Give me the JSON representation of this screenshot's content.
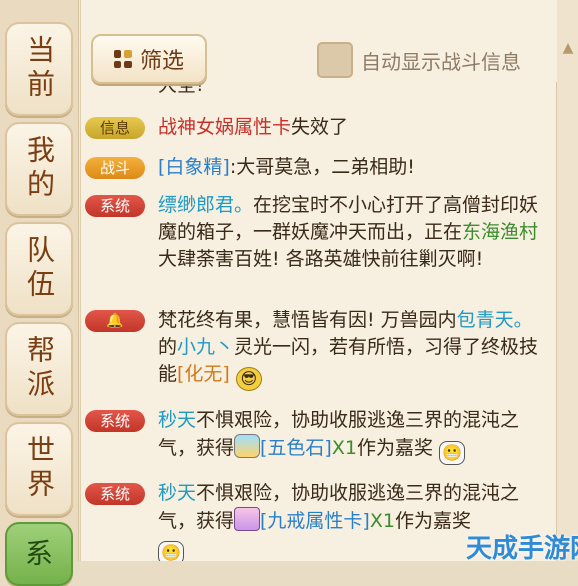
{
  "tabs": [
    {
      "label": "当前",
      "active": false
    },
    {
      "label": "我的",
      "active": false
    },
    {
      "label": "队伍",
      "active": false
    },
    {
      "label": "帮派",
      "active": false
    },
    {
      "label": "世界",
      "active": false
    },
    {
      "label": "系",
      "active": true
    }
  ],
  "toolbar": {
    "filter_label": "筛选",
    "auto_show_battle_label": "自动显示战斗信息",
    "auto_show_battle_checked": false
  },
  "messages": [
    {
      "channel": "",
      "parts": [
        {
          "t": "大全!",
          "c": ""
        }
      ]
    },
    {
      "channel": "信息",
      "parts": [
        {
          "t": "战神女娲属性卡",
          "c": "red"
        },
        {
          "t": "失效了",
          "c": ""
        }
      ]
    },
    {
      "channel": "战斗",
      "parts": [
        {
          "t": "[白象精]",
          "c": "blue"
        },
        {
          "t": ":大哥莫急，二弟相助!",
          "c": ""
        }
      ]
    },
    {
      "channel": "系统",
      "parts": [
        {
          "t": "缥缈郎君。",
          "c": "cyan"
        },
        {
          "t": "在挖宝时不小心打开了高僧封印妖魔的箱子，一群妖魔冲天而出，正在",
          "c": ""
        },
        {
          "t": "东海渔村",
          "c": "green"
        },
        {
          "t": "大肆荼害百姓! 各路英雄快前往剿灭啊!",
          "c": ""
        }
      ]
    },
    {
      "channel": "",
      "parts": [
        {
          "t": "梵花终有果，慧悟皆有因! 万兽园内",
          "c": ""
        },
        {
          "t": "包青天。",
          "c": "cyan"
        },
        {
          "t": "的",
          "c": ""
        },
        {
          "t": "小九丶",
          "c": "cyan"
        },
        {
          "t": "灵光一闪，若有所悟，习得了终极技能",
          "c": ""
        },
        {
          "t": "[化无]",
          "c": "orange"
        }
      ]
    },
    {
      "channel": "系统",
      "parts": [
        {
          "t": "秒天",
          "c": "cyan"
        },
        {
          "t": "不惧艰险，协助收服逃逸三界的混沌之气，获得",
          "c": ""
        },
        {
          "t": "[五色石]",
          "c": "blue"
        },
        {
          "t": "X1",
          "c": "green"
        },
        {
          "t": "作为嘉奖",
          "c": ""
        }
      ]
    },
    {
      "channel": "系统",
      "parts": [
        {
          "t": "秒天",
          "c": "cyan"
        },
        {
          "t": "不惧艰险，协助收服逃逸三界的混沌之气，获得",
          "c": ""
        },
        {
          "t": "[九戒属性卡]",
          "c": "blue"
        },
        {
          "t": "X1",
          "c": "green"
        },
        {
          "t": "作为嘉奖",
          "c": ""
        }
      ]
    }
  ],
  "watermark": "天成手游网",
  "colors": {
    "accent_green": "#74b24b",
    "system_red": "#c23528",
    "link_blue": "#2a7fc9",
    "info_yellow": "#e7c84f",
    "battle_orange": "#f3b13c"
  }
}
